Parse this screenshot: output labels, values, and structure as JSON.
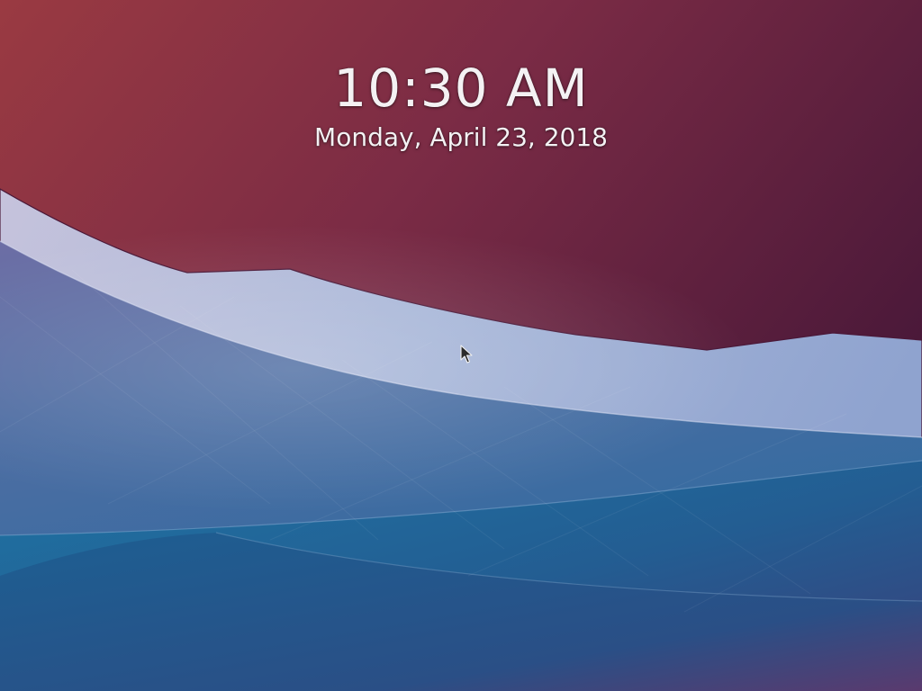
{
  "lockscreen": {
    "time": "10:30 AM",
    "date": "Monday, April 23, 2018"
  },
  "icons": {
    "pointer": "mouse-pointer-icon"
  },
  "colors": {
    "sky_top_left": "#8f3640",
    "sky_top_right": "#4a1a3c",
    "ridge_highlight": "#a9b6d8",
    "sea_blue": "#23679a",
    "sea_deep": "#1a4a7c",
    "text": "#f4f1f3"
  }
}
